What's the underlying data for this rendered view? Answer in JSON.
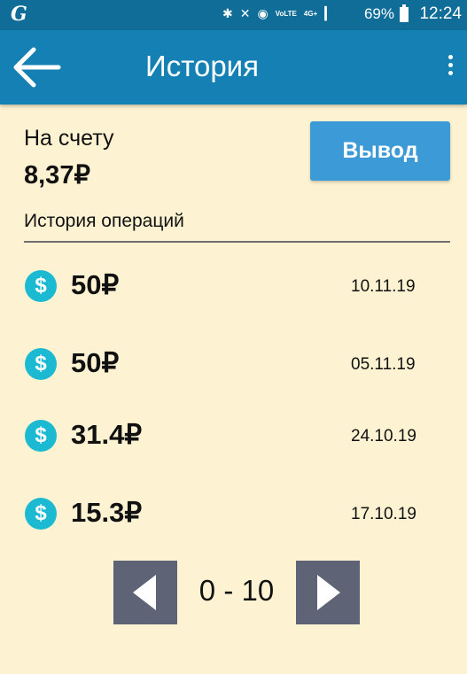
{
  "status_bar": {
    "carrier_logo": "G",
    "signal_labels": [
      "VoLTE",
      "4G+"
    ],
    "battery": "69%",
    "time": "12:24"
  },
  "app_bar": {
    "title": "История",
    "back_icon": "arrow-left-icon",
    "menu_icon": "more-vertical-icon"
  },
  "account": {
    "balance_label": "На счету",
    "balance_value": "8,37₽",
    "withdraw_label": "Вывод"
  },
  "history": {
    "title": "История операций",
    "operations": [
      {
        "icon": "$",
        "amount": "50₽",
        "date": "10.11.19"
      },
      {
        "icon": "$",
        "amount": "50₽",
        "date": "05.11.19"
      },
      {
        "icon": "$",
        "amount": "31.4₽",
        "date": "24.10.19"
      },
      {
        "icon": "$",
        "amount": "15.3₽",
        "date": "17.10.19"
      }
    ]
  },
  "pager": {
    "range": "0 - 10",
    "prev_icon": "triangle-left-icon",
    "next_icon": "triangle-right-icon"
  },
  "colors": {
    "status_bar": "#0f6d98",
    "app_bar": "#1580b4",
    "background": "#fdf3d2",
    "button": "#3c9ad6",
    "coin": "#1bbad2",
    "pager_button": "#5e6475"
  }
}
